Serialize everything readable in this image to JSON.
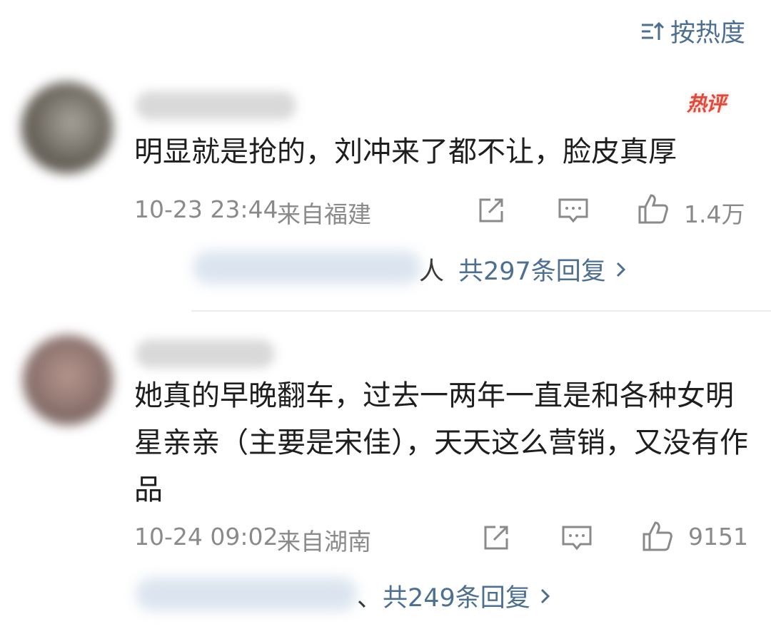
{
  "sort": {
    "label": "按热度"
  },
  "comments": [
    {
      "hot_badge": "热评",
      "text": "明显就是抢的，刘冲来了都不让，脸皮真厚",
      "time": "10-23 23:44",
      "location": "来自福建",
      "likes": "1.4万",
      "reply_prefix": "人",
      "replies": "共297条回复"
    },
    {
      "text": "她真的早晚翻车，过去一两年一直是和各种女明星亲亲（主要是宋佳），天天这么营销，又没有作品",
      "time": "10-24 09:02",
      "location": "来自湖南",
      "likes": "9151",
      "reply_prefix": "、",
      "replies": "共249条回复"
    }
  ],
  "colors": {
    "link": "#4d6f91",
    "meta": "#8a8a8a",
    "hot": "#e04a3a"
  }
}
